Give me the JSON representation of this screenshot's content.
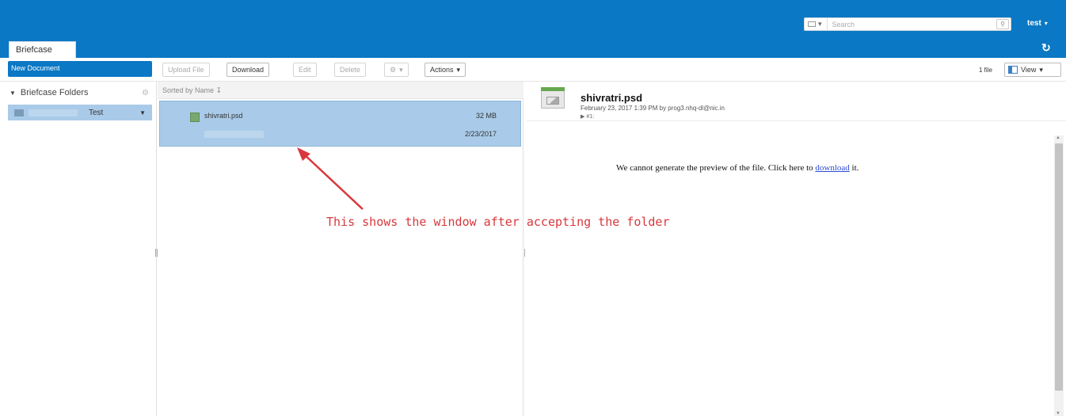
{
  "header": {
    "search": {
      "placeholder": "Search"
    },
    "user_label": "test",
    "tabs": [
      {
        "label": "Briefcase"
      }
    ]
  },
  "toolbar": {
    "new_document_label": "New Document",
    "upload_label": "Upload File",
    "download_label": "Download",
    "edit_label": "Edit",
    "delete_label": "Delete",
    "actions_label": "Actions",
    "file_count": "1 file",
    "view_label": "View"
  },
  "sidebar": {
    "header_label": "Briefcase Folders",
    "folder_label": "Test"
  },
  "list": {
    "sort_label": "Sorted by Name",
    "files": [
      {
        "name": "shivratri.psd",
        "size": "32 MB",
        "date": "2/23/2017"
      }
    ]
  },
  "preview": {
    "title": "shivratri.psd",
    "meta": "February 23, 2017 1:39 PM by prog3.nhq-dl@nic.in",
    "tags": "▶ #1:",
    "message_before": "We cannot generate the preview of the file. Click here to ",
    "link_text": "download",
    "message_after": " it."
  },
  "annotation": {
    "text": "This shows the window after accepting the folder",
    "color": "#d8383c"
  },
  "colors": {
    "brand": "#0a78c4",
    "selection": "#a9cbe9"
  }
}
